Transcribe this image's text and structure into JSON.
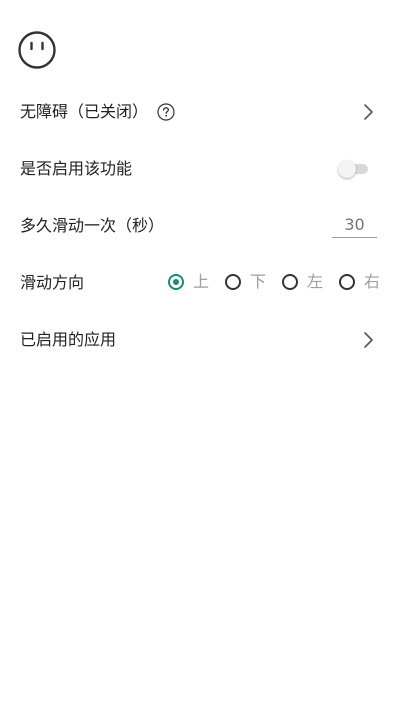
{
  "header": {
    "icon": "face-icon"
  },
  "rows": {
    "accessibility": {
      "label": "无障碍（已关闭）",
      "help_icon": "question-circle-icon",
      "chevron_icon": "chevron-right-icon"
    },
    "enable_feature": {
      "label": "是否启用该功能",
      "toggle_on": false
    },
    "interval": {
      "label": "多久滑动一次（秒）",
      "placeholder": "30"
    },
    "direction": {
      "label": "滑动方向",
      "options": [
        "上",
        "下",
        "左",
        "右"
      ],
      "selected": "上"
    },
    "enabled_apps": {
      "label": "已启用的应用",
      "chevron_icon": "chevron-right-icon"
    }
  },
  "colors": {
    "accent": "#1a8a7a",
    "text": "#222222",
    "muted": "#9e9e9e"
  }
}
